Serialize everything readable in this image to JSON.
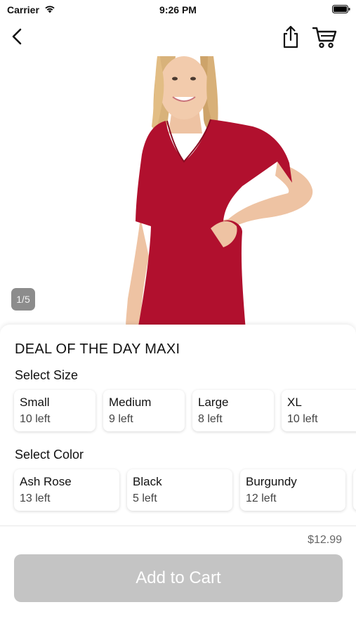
{
  "status_bar": {
    "carrier": "Carrier",
    "time": "9:26 PM"
  },
  "nav": {
    "icons": [
      "back-icon",
      "share-icon",
      "cart-icon"
    ]
  },
  "gallery": {
    "indicator": "1/5",
    "dress_color": "#b1102e"
  },
  "product": {
    "title": "DEAL OF THE DAY MAXI"
  },
  "size_section": {
    "label": "Select Size",
    "options": [
      {
        "name": "Small",
        "stock": "10 left"
      },
      {
        "name": "Medium",
        "stock": "9 left"
      },
      {
        "name": "Large",
        "stock": "8 left"
      },
      {
        "name": "XL",
        "stock": "10 left"
      }
    ]
  },
  "color_section": {
    "label": "Select Color",
    "options": [
      {
        "name": "Ash Rose",
        "stock": "13 left"
      },
      {
        "name": "Black",
        "stock": "5 left"
      },
      {
        "name": "Burgundy",
        "stock": "12 left"
      }
    ]
  },
  "footer": {
    "price": "$12.99",
    "add_to_cart": "Add to Cart",
    "button_color": "#c4c4c4"
  }
}
